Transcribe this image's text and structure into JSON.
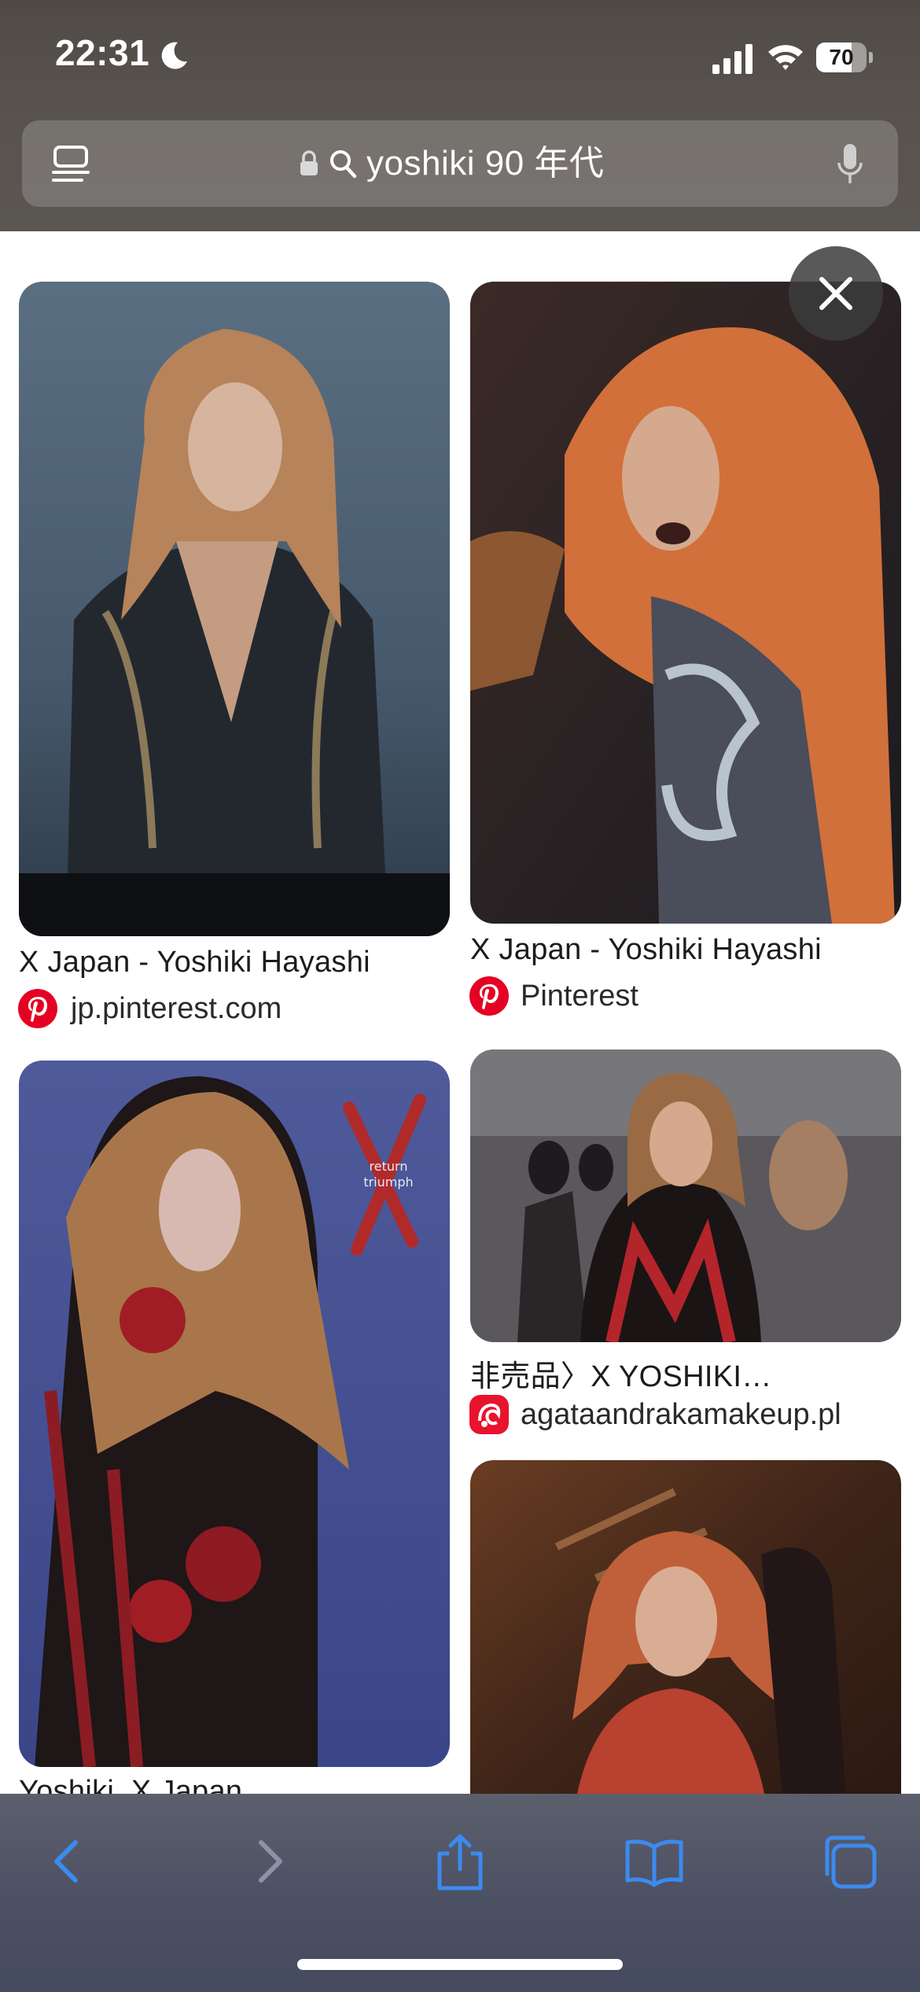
{
  "status_bar": {
    "time": "22:31",
    "battery_level": "70",
    "battery_fraction": 0.7
  },
  "url_bar": {
    "query": "yoshiki 90 年代"
  },
  "results": [
    {
      "title": "X Japan - Yoshiki Hayashi",
      "source": "jp.pinterest.com",
      "source_icon": "pinterest-icon"
    },
    {
      "title": "X Japan - Yoshiki Hayashi",
      "source": "Pinterest",
      "source_icon": "pinterest-icon"
    },
    {
      "title": "",
      "source": "",
      "source_icon": ""
    },
    {
      "title": "非売品〉X YOSHIKI…",
      "source": "agataandrakamakeup.pl",
      "source_icon": "agata-site-icon"
    },
    {
      "title": "Yoshiki, X Japan",
      "source": "",
      "source_icon": ""
    }
  ],
  "image_overlay_text": {
    "logo_text_line1": "return",
    "logo_text_line2": "triumph",
    "logo_letter": "X"
  },
  "toolbar": {
    "back": "chevron-left-icon",
    "forward": "chevron-right-icon",
    "share": "share-icon",
    "bookmarks": "book-icon",
    "tabs": "tabs-icon"
  },
  "colors": {
    "accent": "#3b8bf0",
    "toolbar_disabled": "#8d93a6"
  }
}
